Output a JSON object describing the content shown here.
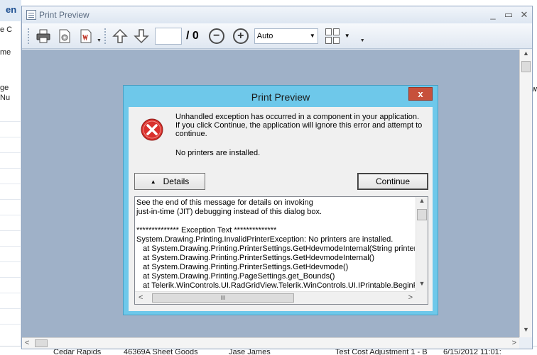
{
  "background_app": {
    "header_fragment": "en",
    "left_fragments": [
      "e C",
      "me",
      "ge",
      "Nu"
    ],
    "bottom_row": [
      "Cedar Rapids",
      "46369A Sheet Goods",
      "Jase James",
      "Test Cost Adjustment 1 - B",
      "6/15/2012 11:01:"
    ],
    "right_fragment": "w"
  },
  "print_preview": {
    "title": "Print Preview",
    "window_controls": [
      "_",
      "▭",
      "✕"
    ],
    "toolbar": {
      "page_value": "",
      "page_total": "/ 0",
      "zoom_minus": "−",
      "zoom_plus": "+",
      "zoom_value": "Auto"
    }
  },
  "dialog": {
    "title": "Print Preview",
    "close_label": "x",
    "message": "Unhandled exception has occurred in a component in your application. If you click Continue, the application will ignore this error and attempt to continue.",
    "message2": "No printers are installed.",
    "details_label": "Details",
    "continue_label": "Continue",
    "details_text": "See the end of this message for details on invoking\njust-in-time (JIT) debugging instead of this dialog box.\n\n************** Exception Text **************\nSystem.Drawing.Printing.InvalidPrinterException: No printers are installed.\n   at System.Drawing.Printing.PrinterSettings.GetHdevmodeInternal(String printer)\n   at System.Drawing.Printing.PrinterSettings.GetHdevmodeInternal()\n   at System.Drawing.Printing.PrinterSettings.GetHdevmode()\n   at System.Drawing.Printing.PageSettings.get_Bounds()\n   at Telerik.WinControls.UI.RadGridView.Telerik.WinControls.UI.IPrintable.BeginPrint",
    "hscroll_thumb": "III"
  },
  "colors": {
    "dialog_frame": "#6ec8ea",
    "close_button": "#c7503b",
    "canvas": "#9fb1c8",
    "error_icon": "#d9302c"
  }
}
